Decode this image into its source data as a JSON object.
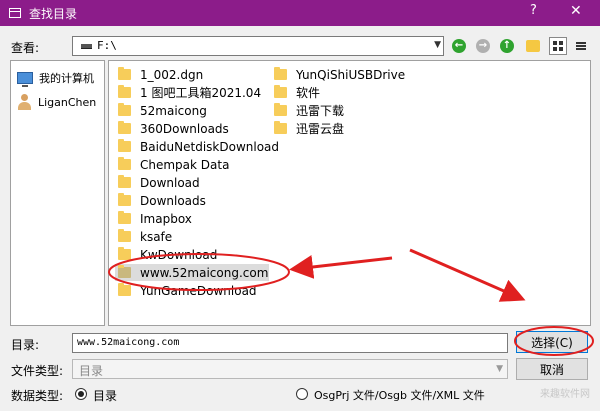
{
  "window": {
    "title": "查找目录",
    "help_glyph": "?",
    "close_glyph": "✕"
  },
  "lookin": {
    "label": "查看:",
    "value": "F:\\"
  },
  "sidebar": {
    "items": [
      {
        "label": "我的计算机",
        "icon": "computer-icon"
      },
      {
        "label": "LiganChen",
        "icon": "user-folder-icon"
      }
    ]
  },
  "files": {
    "column1": [
      "1_002.dgn",
      "1 图吧工具箱2021.04",
      "52maicong",
      "360Downloads",
      "BaiduNetdiskDownload",
      "Chempak Data",
      "Download",
      "Downloads",
      "Imapbox",
      "ksafe",
      "KwDownload",
      "www.52maicong.com",
      "YunGameDownload"
    ],
    "column2": [
      "YunQiShiUSBDrive",
      "软件",
      "迅雷下载",
      "迅雷云盘"
    ],
    "selected": "www.52maicong.com"
  },
  "directory": {
    "label": "目录:",
    "value": "www.52maicong.com"
  },
  "filetype": {
    "label": "文件类型:",
    "value": "目录"
  },
  "datatype": {
    "label": "数据类型:",
    "options": [
      "目录",
      "OsgPrj 文件/Osgb 文件/XML 文件"
    ],
    "selected_index": 0
  },
  "buttons": {
    "select_label": "选择(C)",
    "cancel_label": "取消"
  },
  "watermark": "来趣软件网",
  "colors": {
    "titlebar": "#8c1c8a",
    "annotation_red": "#e02020",
    "accent": "#0078d7"
  }
}
